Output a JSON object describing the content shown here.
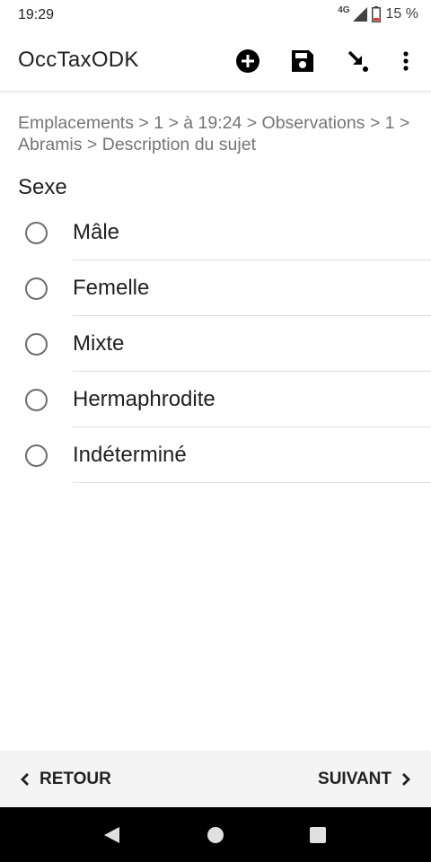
{
  "status_bar": {
    "time": "19:29",
    "network_type": "4G",
    "battery_percent": "15 %"
  },
  "app_bar": {
    "title": "OccTaxODK",
    "actions": [
      "add-circle-icon",
      "save-icon",
      "finish-arrow-icon",
      "more-vert-icon"
    ]
  },
  "breadcrumb": "Emplacements > 1 > à 19:24 > Observations > 1 > Abramis > Description du sujet",
  "question": {
    "label": "Sexe",
    "options": [
      "Mâle",
      "Femelle",
      "Mixte",
      "Hermaphrodite",
      "Indéterminé"
    ]
  },
  "navigation": {
    "back_label": "RETOUR",
    "next_label": "SUIVANT"
  },
  "colors": {
    "battery_low": "#e53935"
  }
}
